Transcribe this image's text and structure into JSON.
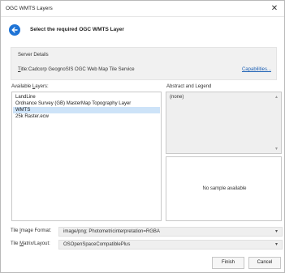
{
  "window": {
    "title": "OGC WMTS Layers",
    "close_glyph": "✕"
  },
  "header": {
    "heading": "Select the required OGC WMTS Layer",
    "back_icon": "back-arrow-icon",
    "accent": "#1f74d6"
  },
  "server_details": {
    "legend": "Server Details",
    "title_label_underlined": "T",
    "title_label_rest": "itle:",
    "title_value": "Cadcorp GeognoSIS OGC Web Map Tile Service",
    "capabilities_link": "Capabilities..."
  },
  "layers": {
    "label_prefix": "Available ",
    "label_underlined": "L",
    "label_suffix": "ayers:",
    "items": [
      {
        "label": "LandLine",
        "selected": false
      },
      {
        "label": "Ordnance Survey (GB) MasterMap Topography Layer",
        "selected": false
      },
      {
        "label": "WMTS",
        "selected": true
      },
      {
        "label": "25k Raster.ecw",
        "selected": false
      }
    ]
  },
  "abstract": {
    "label": "Abstract and Legend",
    "text": "(none)"
  },
  "sample": {
    "text": "No sample available"
  },
  "tile_format": {
    "label_prefix": "Tile ",
    "label_underlined": "I",
    "label_suffix": "mage Format:",
    "value": "image/png; Photometricinterpretation=RGBA"
  },
  "tile_matrix": {
    "label_prefix": "Tile ",
    "label_underlined": "M",
    "label_suffix": "atrix/Layout:",
    "value": "OSOpenSpaceCompatiblePlus"
  },
  "footer": {
    "finish_label": "Finish",
    "cancel_label": "Cancel"
  }
}
